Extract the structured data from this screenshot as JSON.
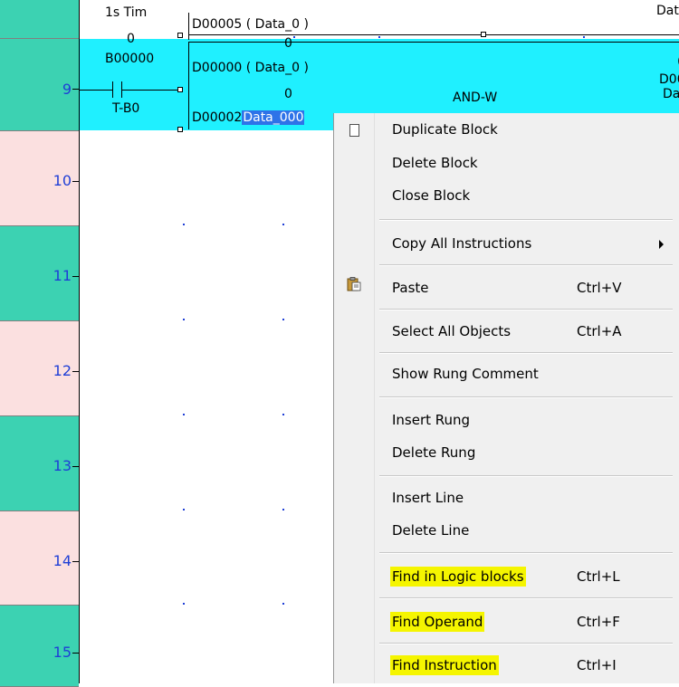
{
  "rungs": [
    {
      "number": "9",
      "color": "teal"
    },
    {
      "number": "10",
      "color": "pink"
    },
    {
      "number": "11",
      "color": "teal"
    },
    {
      "number": "12",
      "color": "pink"
    },
    {
      "number": "13",
      "color": "teal"
    },
    {
      "number": "14",
      "color": "pink"
    },
    {
      "number": "15",
      "color": "teal"
    }
  ],
  "ladder": {
    "timer_label": "1s Tim",
    "top_operand": "D00005 ( Data_0 )",
    "top_right_partial": "Dat",
    "contact_value": "0",
    "contact_address": "B00000",
    "contact_label": "T-B0",
    "value_top": "0",
    "operand_1": "D00000 ( Data_0 )",
    "value_mid": "0",
    "operand_2_prefix": "D00002",
    "operand_2_selected": "Data_000",
    "instruction": "AND-W",
    "right_partial_1": "(",
    "right_partial_2": "D00",
    "right_partial_3": "Da"
  },
  "context_menu": {
    "items": [
      {
        "label": "Duplicate Block",
        "shortcut": "",
        "icon": "document-icon"
      },
      {
        "label": "Delete Block",
        "shortcut": ""
      },
      {
        "label": "Close Block",
        "shortcut": ""
      },
      {
        "label": "Copy All  Instructions",
        "shortcut": "",
        "submenu": true
      },
      {
        "label": "Paste",
        "shortcut": "Ctrl+V",
        "icon": "paste-icon"
      },
      {
        "label": "Select All Objects",
        "shortcut": "Ctrl+A"
      },
      {
        "label": "Show Rung Comment",
        "shortcut": ""
      },
      {
        "label": "Insert Rung",
        "shortcut": ""
      },
      {
        "label": "Delete Rung",
        "shortcut": ""
      },
      {
        "label": "Insert Line",
        "shortcut": ""
      },
      {
        "label": "Delete Line",
        "shortcut": ""
      },
      {
        "label": "Find in Logic blocks",
        "shortcut": "Ctrl+L",
        "highlighted": true
      },
      {
        "label": "Find Operand",
        "shortcut": "Ctrl+F",
        "highlighted": true
      },
      {
        "label": "Find Instruction",
        "shortcut": "Ctrl+I",
        "highlighted": true
      }
    ]
  },
  "colors": {
    "teal": "#3cd2b2",
    "pink": "#fbe0e0",
    "selection_cyan": "#1ff0ff",
    "marker_yellow": "#f5f500"
  }
}
